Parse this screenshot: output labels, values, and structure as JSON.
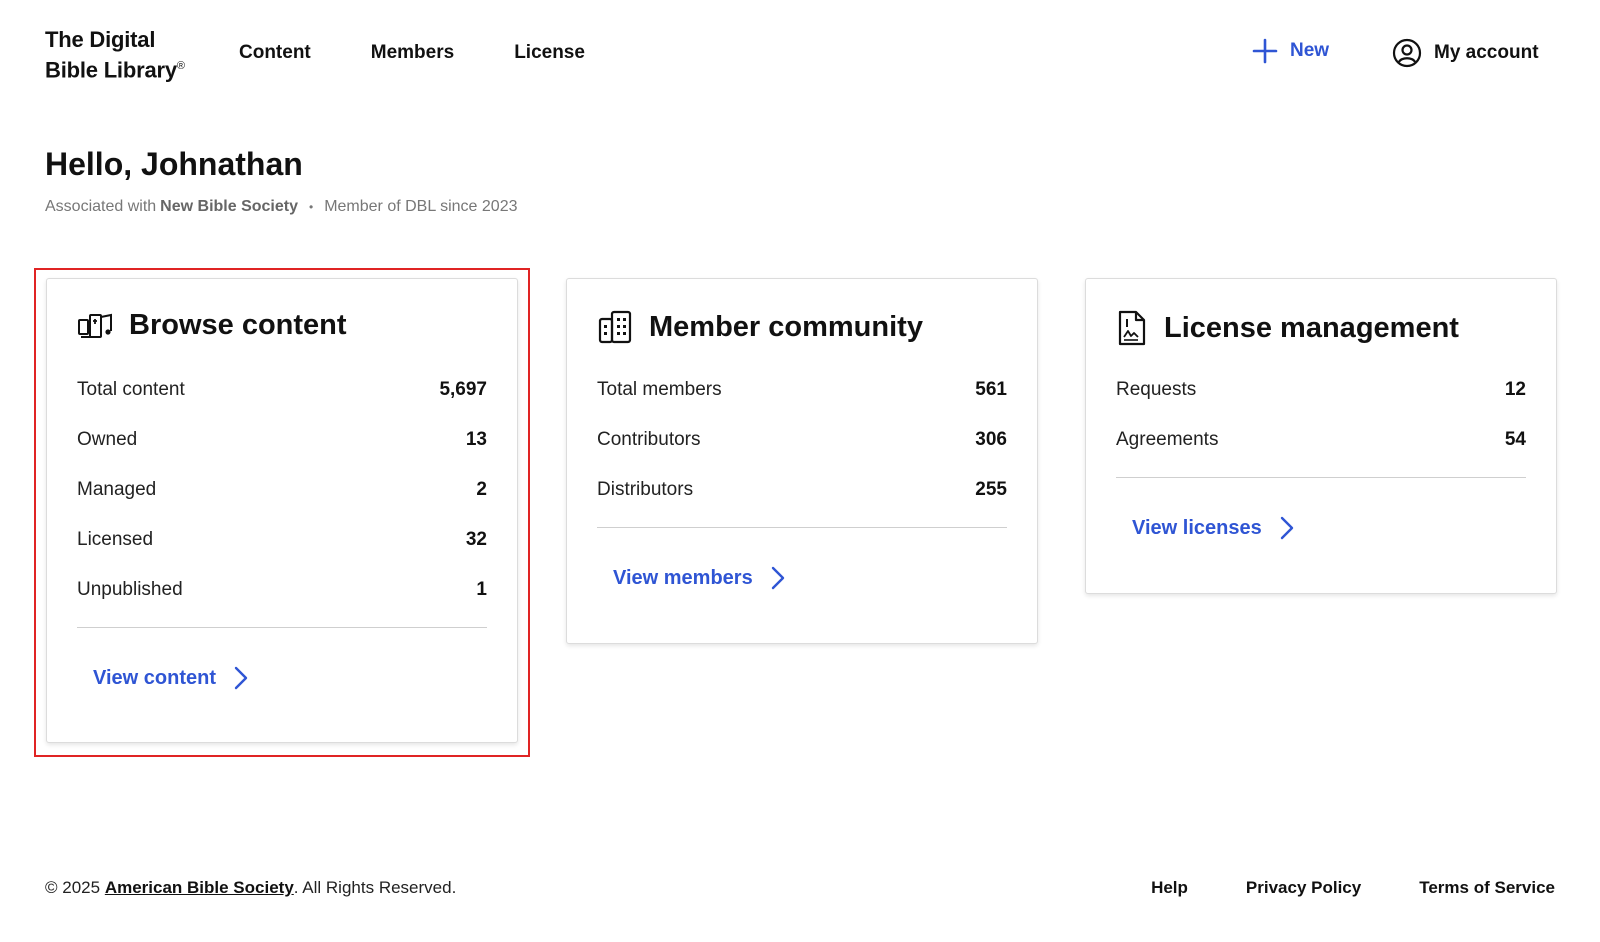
{
  "header": {
    "logo_line1": "The Digital",
    "logo_line2": "Bible Library",
    "logo_reg": "®",
    "nav": [
      "Content",
      "Members",
      "License"
    ],
    "new_label": "New",
    "account_label": "My account"
  },
  "greeting": {
    "title": "Hello, Johnathan",
    "associated_prefix": "Associated with",
    "organization": "New Bible Society",
    "separator": "•",
    "member_since": "Member of DBL since 2023"
  },
  "cards": {
    "content": {
      "title": "Browse content",
      "icon": "content-library-icon",
      "stats": [
        {
          "label": "Total content",
          "value": "5,697"
        },
        {
          "label": "Owned",
          "value": "13"
        },
        {
          "label": "Managed",
          "value": "2"
        },
        {
          "label": "Licensed",
          "value": "32"
        },
        {
          "label": "Unpublished",
          "value": "1"
        }
      ],
      "link": "View content"
    },
    "members": {
      "title": "Member community",
      "icon": "building-icon",
      "stats": [
        {
          "label": "Total members",
          "value": "561"
        },
        {
          "label": "Contributors",
          "value": "306"
        },
        {
          "label": "Distributors",
          "value": "255"
        }
      ],
      "link": "View members"
    },
    "license": {
      "title": "License management",
      "icon": "signed-document-icon",
      "stats": [
        {
          "label": "Requests",
          "value": "12"
        },
        {
          "label": "Agreements",
          "value": "54"
        }
      ],
      "link": "View licenses"
    }
  },
  "footer": {
    "copyright_prefix": "© 2025",
    "organization_link": "American Bible Society",
    "copyright_suffix": ". All Rights Reserved.",
    "links": [
      "Help",
      "Privacy Policy",
      "Terms of Service"
    ]
  },
  "colors": {
    "accent": "#2f55d4",
    "highlight": "#e02424"
  }
}
